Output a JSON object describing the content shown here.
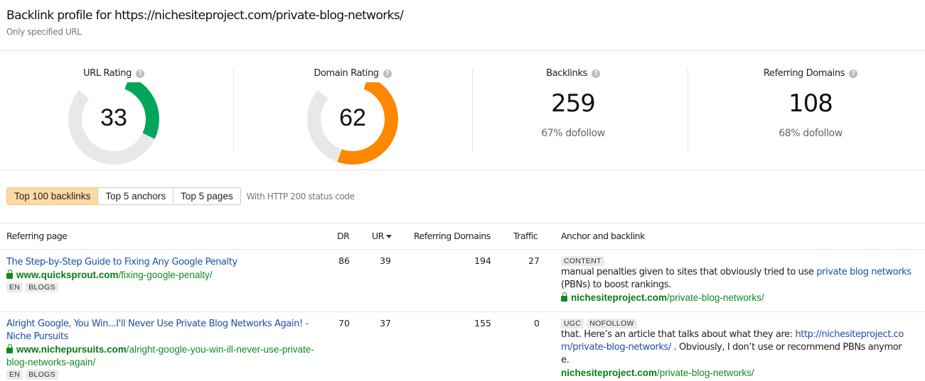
{
  "header": {
    "title": "Backlink profile for https://nichesiteproject.com/private-blog-networks/",
    "subtitle": "Only specified URL"
  },
  "metrics": {
    "url_rating": {
      "label": "URL Rating",
      "value": "33",
      "fraction": 0.33,
      "color": "#00a65a",
      "track_color": "#e8e8ea"
    },
    "domain_rating": {
      "label": "Domain Rating",
      "value": "62",
      "fraction": 0.62,
      "color": "#ff8800",
      "track_color": "#e8e8ea"
    },
    "backlinks": {
      "label": "Backlinks",
      "value": "259",
      "dofollow": "67% dofollow"
    },
    "referring_domains": {
      "label": "Referring Domains",
      "value": "108",
      "dofollow": "68% dofollow"
    },
    "help_icon": "?"
  },
  "tabs": {
    "items": [
      {
        "label": "Top 100 backlinks",
        "active": true
      },
      {
        "label": "Top 5 anchors",
        "active": false
      },
      {
        "label": "Top 5 pages",
        "active": false
      }
    ],
    "note": "With HTTP 200 status code"
  },
  "table": {
    "columns": {
      "referring_page": "Referring page",
      "dr": "DR",
      "ur": "UR",
      "referring_domains": "Referring Domains",
      "traffic": "Traffic",
      "anchor": "Anchor and backlink"
    },
    "sorted_by": "UR",
    "rows": [
      {
        "title": "The Step-by-Step Guide to Fixing Any Google Penalty",
        "url_domain": "www.quicksprout.com",
        "url_path": "/fixing-google-penalty/",
        "secure": true,
        "tags": [
          "EN",
          "BLOGS"
        ],
        "dr": "86",
        "ur": "39",
        "referring_domains": "194",
        "traffic": "27",
        "link_tags": [
          "CONTENT"
        ],
        "anchor_before": "manual penalties given to sites that obviously tried to use ",
        "anchor_link": "private blog networks",
        "anchor_after": " (PBNs) to boost rankings.",
        "target_domain": "nichesiteproject.com",
        "target_path": "/private-blog-networks/",
        "target_secure": true
      },
      {
        "title": "Alright Google, You Win...I'll Never Use Private Blog Networks Again! - Niche Pursuits",
        "url_domain": "www.nichepursuits.com",
        "url_path": "/alright-google-you-win-ill-never-use-private-blog-networks-again/",
        "secure": true,
        "tags": [
          "EN",
          "BLOGS"
        ],
        "dr": "70",
        "ur": "37",
        "referring_domains": "155",
        "traffic": "0",
        "link_tags": [
          "UGC",
          "NOFOLLOW"
        ],
        "anchor_before": "that. Here’s an article that talks about what they are: ",
        "anchor_link": "http://nichesiteproject.com/private-blog-networks/",
        "anchor_after": " . Obviously, I don’t use or recommend PBNs anymore.",
        "target_domain": "nichesiteproject.com",
        "target_path": "/private-blog-networks/",
        "target_secure": false
      }
    ]
  }
}
